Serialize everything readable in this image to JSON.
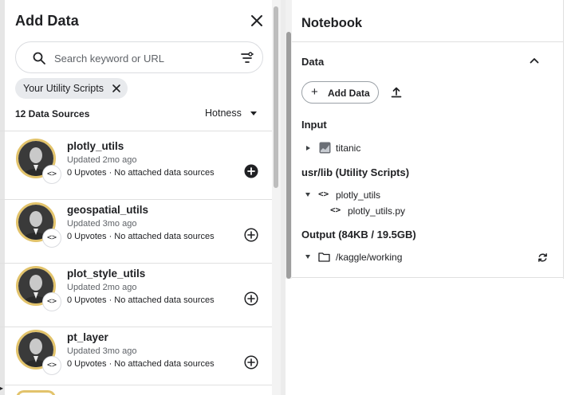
{
  "add_data": {
    "title": "Add Data",
    "search": {
      "placeholder": "Search keyword or URL",
      "value": ""
    },
    "filter_chip": "Your Utility Scripts",
    "sources_count": "12 Data Sources",
    "sort": {
      "selected": "Hotness"
    },
    "items": [
      {
        "title": "plotly_utils",
        "updated": "Updated 2mo ago",
        "meta": "0 Upvotes · No attached data sources",
        "added": true
      },
      {
        "title": "geospatial_utils",
        "updated": "Updated 3mo ago",
        "meta": "0 Upvotes · No attached data sources",
        "added": false
      },
      {
        "title": "plot_style_utils",
        "updated": "Updated 2mo ago",
        "meta": "0 Upvotes · No attached data sources",
        "added": false
      },
      {
        "title": "pt_layer",
        "updated": "Updated 3mo ago",
        "meta": "0 Upvotes · No attached data sources",
        "added": false
      }
    ],
    "icons": {
      "close": "close-icon",
      "search": "search-icon",
      "filter": "filter-icon",
      "add": "add-circle-icon",
      "added": "add-circle-filled-icon",
      "code": "code-icon"
    }
  },
  "notebook": {
    "title": "Notebook",
    "data_section": "Data",
    "add_data_button": "Add Data",
    "input": {
      "heading": "Input",
      "items": [
        {
          "label": "titanic"
        }
      ]
    },
    "utility": {
      "heading": "usr/lib (Utility Scripts)",
      "folder": "plotly_utils",
      "file": "plotly_utils.py"
    },
    "output": {
      "heading": "Output (84KB / 19.5GB)",
      "path": "/kaggle/working"
    }
  },
  "colors": {
    "accent_ring": "#e2c36b",
    "text": "#202124",
    "muted": "#5f6368",
    "chip_bg": "#e8eaed"
  }
}
